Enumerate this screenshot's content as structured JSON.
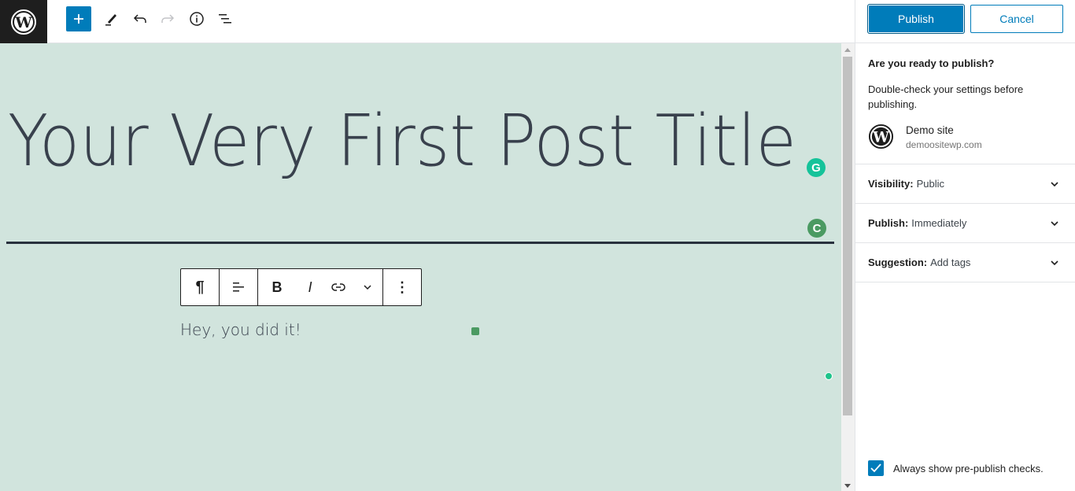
{
  "toolbar": {
    "logo": "wordpress-logo",
    "add_block": "Add block",
    "tools": [
      "add-block",
      "edit-tool",
      "undo",
      "redo",
      "details",
      "list-view"
    ]
  },
  "editor": {
    "post_title": "Your Very First Post Title",
    "paragraph": "Hey, you did it!",
    "block_toolbar": {
      "paragraph_symbol": "¶",
      "bold": "B",
      "italic": "I",
      "more": "⋮"
    },
    "background_color": "#d1e4dd",
    "text_color": "#39414d"
  },
  "sidebar": {
    "publish_label": "Publish",
    "cancel_label": "Cancel",
    "ready_heading": "Are you ready to publish?",
    "double_check": "Double-check your settings before publishing.",
    "site_name": "Demo site",
    "site_url": "demoositewp.com",
    "panels": [
      {
        "label": "Visibility:",
        "value": "Public"
      },
      {
        "label": "Publish:",
        "value": "Immediately"
      },
      {
        "label": "Suggestion:",
        "value": "Add tags"
      }
    ],
    "always_show_label": "Always show pre-publish checks.",
    "always_show_checked": true,
    "accent_color": "#007cba"
  }
}
